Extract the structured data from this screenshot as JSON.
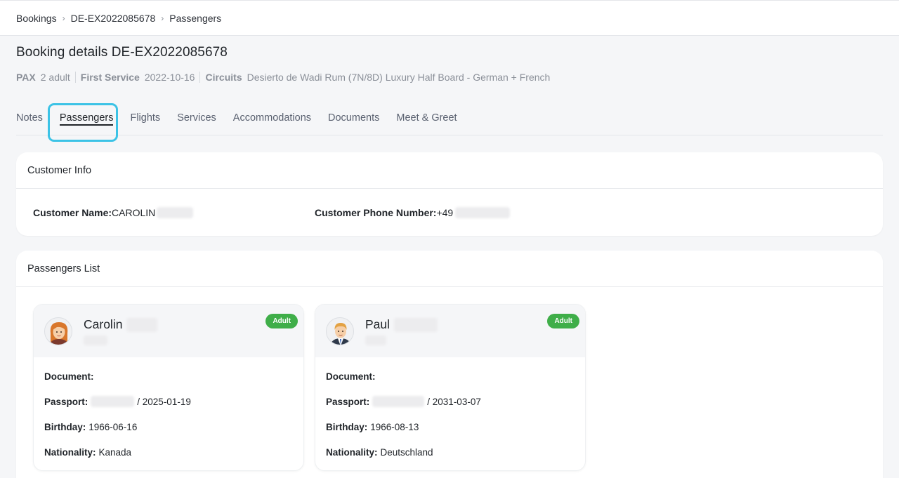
{
  "breadcrumb": {
    "items": [
      "Bookings",
      "DE-EX2022085678",
      "Passengers"
    ],
    "separator": "›"
  },
  "page": {
    "title": "Booking details DE-EX2022085678",
    "meta": [
      {
        "key": "PAX",
        "value": "2 adult"
      },
      {
        "key": "First Service",
        "value": "2022-10-16"
      },
      {
        "key": "Circuits",
        "value": "Desierto de Wadi Rum (7N/8D) Luxury Half Board - German + French"
      }
    ]
  },
  "tabs": [
    {
      "label": "Notes",
      "active": false
    },
    {
      "label": "Passengers",
      "active": true
    },
    {
      "label": "Flights",
      "active": false
    },
    {
      "label": "Services",
      "active": false
    },
    {
      "label": "Accommodations",
      "active": false
    },
    {
      "label": "Documents",
      "active": false
    },
    {
      "label": "Meet & Greet",
      "active": false
    }
  ],
  "customer": {
    "header": "Customer Info",
    "name_label": "Customer Name:",
    "name_value": "CAROLIN",
    "phone_label": "Customer Phone Number:",
    "phone_value": "+49"
  },
  "passengers": {
    "header": "Passengers List",
    "list": [
      {
        "first_name": "Carolin",
        "badge": "Adult",
        "document_label": "Document:",
        "passport_label": "Passport:",
        "passport_expiry": "/ 2025-01-19",
        "birthday_label": "Birthday:",
        "birthday": "1966-06-16",
        "nationality_label": "Nationality:",
        "nationality": "Kanada",
        "avatar": "female-avatar-icon"
      },
      {
        "first_name": "Paul",
        "badge": "Adult",
        "document_label": "Document:",
        "passport_label": "Passport:",
        "passport_expiry": "/ 2031-03-07",
        "birthday_label": "Birthday:",
        "birthday": "1966-08-13",
        "nationality_label": "Nationality:",
        "nationality": "Deutschland",
        "avatar": "male-avatar-icon"
      }
    ]
  },
  "colors": {
    "badge_green": "#3fae49",
    "tab_highlight": "#3cc3e6",
    "background": "#f5f6f8"
  }
}
